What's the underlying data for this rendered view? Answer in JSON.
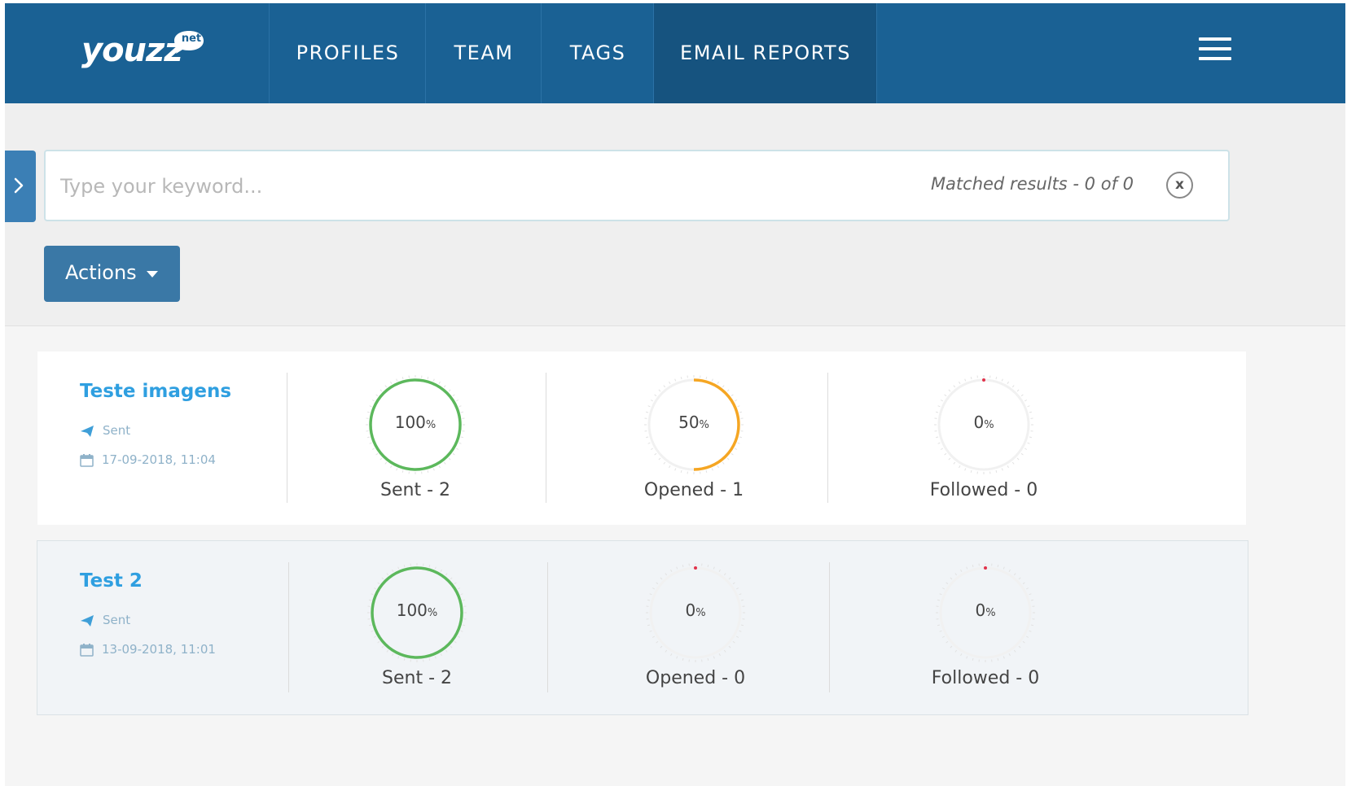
{
  "logo": {
    "wordmark": "youzz",
    "badge": "net"
  },
  "nav": {
    "items": [
      {
        "label": "PROFILES",
        "active": false
      },
      {
        "label": "TEAM",
        "active": false
      },
      {
        "label": "TAGS",
        "active": false
      },
      {
        "label": "EMAIL REPORTS",
        "active": true
      }
    ],
    "menu_icon": "hamburger-icon"
  },
  "search": {
    "placeholder": "Type your keyword...",
    "value": "",
    "matched_text": "Matched results - 0 of 0",
    "clear_label": "x"
  },
  "actions": {
    "label": "Actions"
  },
  "colors": {
    "nav_bg": "#1a6194",
    "nav_active": "#16537f",
    "title_blue": "#2f9fe0",
    "green": "#5cb85c",
    "orange": "#f5a623",
    "red_dot": "#e0334c"
  },
  "reports": [
    {
      "title": "Teste imagens",
      "status": "Sent",
      "date": "17-09-2018, 11:04",
      "metrics": [
        {
          "percent": 100,
          "label": "Sent - 2",
          "color": "#5cb85c"
        },
        {
          "percent": 50,
          "label": "Opened - 1",
          "color": "#f5a623"
        },
        {
          "percent": 0,
          "label": "Followed - 0",
          "color": "#e0334c"
        }
      ]
    },
    {
      "title": "Test 2",
      "status": "Sent",
      "date": "13-09-2018, 11:01",
      "metrics": [
        {
          "percent": 100,
          "label": "Sent - 2",
          "color": "#5cb85c"
        },
        {
          "percent": 0,
          "label": "Opened - 0",
          "color": "#e0334c"
        },
        {
          "percent": 0,
          "label": "Followed - 0",
          "color": "#e0334c"
        }
      ]
    }
  ]
}
